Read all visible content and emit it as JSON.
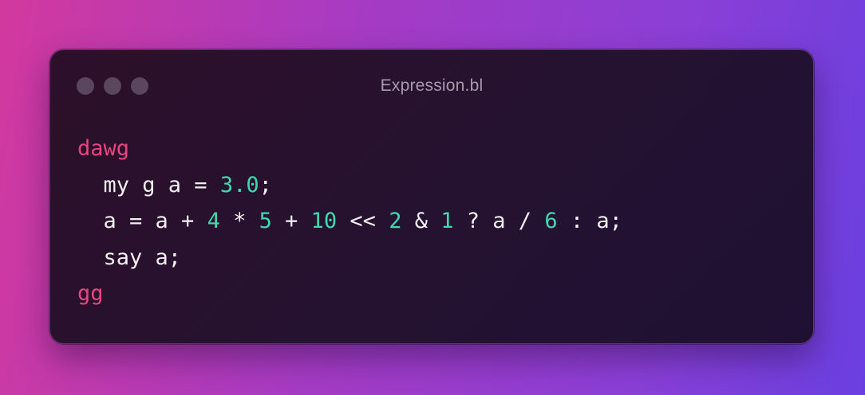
{
  "window": {
    "title": "Expression.bl"
  },
  "code": {
    "lines": [
      {
        "indent": "",
        "tokens": [
          {
            "t": "dawg",
            "k": "kw"
          }
        ]
      },
      {
        "indent": "  ",
        "tokens": [
          {
            "t": "my g a = ",
            "k": "id"
          },
          {
            "t": "3.0",
            "k": "num"
          },
          {
            "t": ";",
            "k": "op"
          }
        ]
      },
      {
        "indent": "  ",
        "tokens": [
          {
            "t": "a = a + ",
            "k": "id"
          },
          {
            "t": "4",
            "k": "num"
          },
          {
            "t": " * ",
            "k": "op"
          },
          {
            "t": "5",
            "k": "num"
          },
          {
            "t": " + ",
            "k": "op"
          },
          {
            "t": "10",
            "k": "num"
          },
          {
            "t": " << ",
            "k": "op"
          },
          {
            "t": "2",
            "k": "num"
          },
          {
            "t": " & ",
            "k": "op"
          },
          {
            "t": "1",
            "k": "num"
          },
          {
            "t": " ? a / ",
            "k": "op"
          },
          {
            "t": "6",
            "k": "num"
          },
          {
            "t": " : a;",
            "k": "op"
          }
        ]
      },
      {
        "indent": "  ",
        "tokens": [
          {
            "t": "say a;",
            "k": "id"
          }
        ]
      },
      {
        "indent": "",
        "tokens": [
          {
            "t": "gg",
            "k": "kw"
          }
        ]
      }
    ]
  },
  "colors": {
    "keyword": "#e8457f",
    "number": "#3fd9b0",
    "text": "#f2eef4",
    "title": "#a79aac"
  },
  "icons": [
    "window-close-dot-icon",
    "window-minimize-dot-icon",
    "window-zoom-dot-icon"
  ]
}
